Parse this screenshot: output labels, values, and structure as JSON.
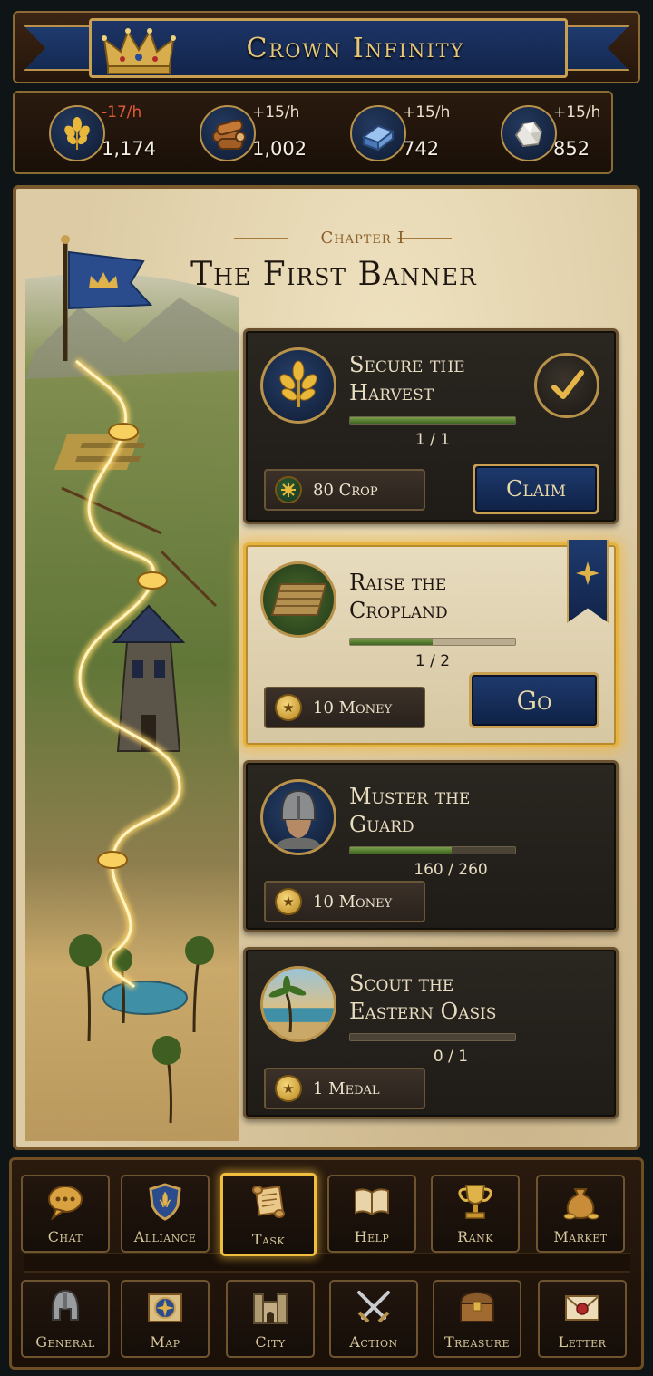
{
  "app": {
    "title": "Crown Infinity"
  },
  "resources": [
    {
      "name": "crop",
      "icon": "wheat-icon",
      "rate": "-17/h",
      "value": "1,174",
      "negative": true
    },
    {
      "name": "wood",
      "icon": "lumber-icon",
      "rate": "+15/h",
      "value": "1,002",
      "negative": false
    },
    {
      "name": "iron",
      "icon": "iron-ingot-icon",
      "rate": "+15/h",
      "value": "742",
      "negative": false
    },
    {
      "name": "stone",
      "icon": "stone-icon",
      "rate": "+15/h",
      "value": "852",
      "negative": false
    }
  ],
  "chapter": {
    "label": "Chapter I",
    "title": "The First Banner"
  },
  "quests": [
    {
      "title_line1": "Secure the",
      "title_line2": "Harvest",
      "progress_text": "1 / 1",
      "progress": 1.0,
      "reward": "80 Crop",
      "reward_icon": "crop-token-icon",
      "action": "Claim",
      "icon": "harvest-icon",
      "state": "complete"
    },
    {
      "title_line1": "Raise the",
      "title_line2": "Cropland",
      "progress_text": "1 / 2",
      "progress": 0.5,
      "reward": "10 Money",
      "reward_icon": "coin-icon",
      "action": "Go",
      "icon": "cropland-icon",
      "state": "active"
    },
    {
      "title_line1": "Muster the",
      "title_line2": "Guard",
      "progress_text": "160 / 260",
      "progress": 0.615,
      "reward": "10 Money",
      "reward_icon": "coin-icon",
      "icon": "guard-icon",
      "state": "pending"
    },
    {
      "title_line1": "Scout the",
      "title_line2": "Eastern Oasis",
      "progress_text": "0 / 1",
      "progress": 0.0,
      "reward": "1 Medal",
      "reward_icon": "medal-icon",
      "icon": "oasis-icon",
      "state": "pending"
    }
  ],
  "nav": {
    "row1": [
      {
        "label": "Chat",
        "icon": "chat-bubble-icon"
      },
      {
        "label": "Alliance",
        "icon": "shield-icon"
      },
      {
        "label": "Task",
        "icon": "scroll-icon",
        "active": true
      },
      {
        "label": "Help",
        "icon": "book-icon"
      },
      {
        "label": "Rank",
        "icon": "trophy-icon"
      },
      {
        "label": "Market",
        "icon": "money-bag-icon"
      }
    ],
    "row2": [
      {
        "label": "General",
        "icon": "helmet-icon"
      },
      {
        "label": "Map",
        "icon": "compass-map-icon"
      },
      {
        "label": "City",
        "icon": "castle-icon"
      },
      {
        "label": "Action",
        "icon": "crossed-swords-icon"
      },
      {
        "label": "Treasure",
        "icon": "chest-icon"
      },
      {
        "label": "Letter",
        "icon": "envelope-icon"
      }
    ]
  },
  "colors": {
    "gold": "#c9a052",
    "navy": "#1e3a6e",
    "parchment": "#dccba4",
    "active_glow": "#f0bd3f",
    "negative_rate": "#e05a3a"
  }
}
